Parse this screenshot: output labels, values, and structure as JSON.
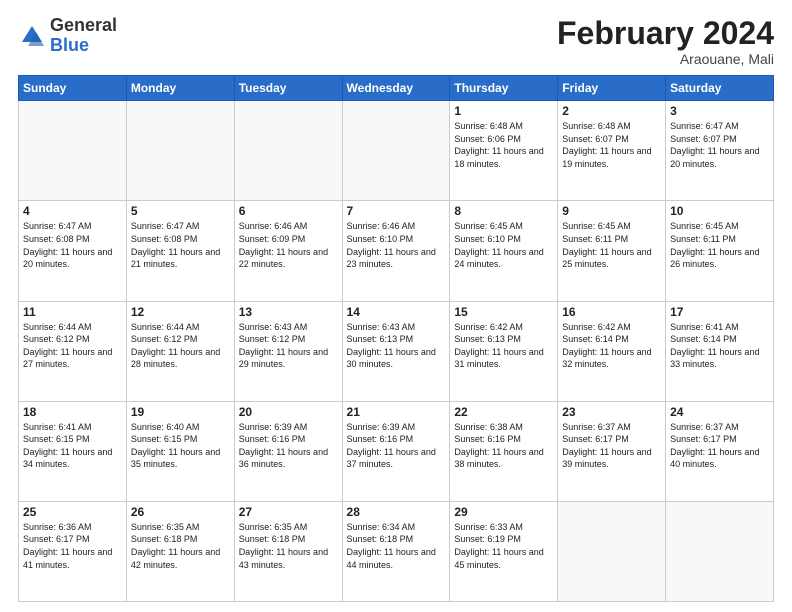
{
  "header": {
    "logo_general": "General",
    "logo_blue": "Blue",
    "month_title": "February 2024",
    "location": "Araouane, Mali"
  },
  "days_of_week": [
    "Sunday",
    "Monday",
    "Tuesday",
    "Wednesday",
    "Thursday",
    "Friday",
    "Saturday"
  ],
  "weeks": [
    [
      {
        "day": "",
        "info": "",
        "empty": true
      },
      {
        "day": "",
        "info": "",
        "empty": true
      },
      {
        "day": "",
        "info": "",
        "empty": true
      },
      {
        "day": "",
        "info": "",
        "empty": true
      },
      {
        "day": "1",
        "info": "Sunrise: 6:48 AM\nSunset: 6:06 PM\nDaylight: 11 hours and 18 minutes.",
        "empty": false
      },
      {
        "day": "2",
        "info": "Sunrise: 6:48 AM\nSunset: 6:07 PM\nDaylight: 11 hours and 19 minutes.",
        "empty": false
      },
      {
        "day": "3",
        "info": "Sunrise: 6:47 AM\nSunset: 6:07 PM\nDaylight: 11 hours and 20 minutes.",
        "empty": false
      }
    ],
    [
      {
        "day": "4",
        "info": "Sunrise: 6:47 AM\nSunset: 6:08 PM\nDaylight: 11 hours and 20 minutes.",
        "empty": false
      },
      {
        "day": "5",
        "info": "Sunrise: 6:47 AM\nSunset: 6:08 PM\nDaylight: 11 hours and 21 minutes.",
        "empty": false
      },
      {
        "day": "6",
        "info": "Sunrise: 6:46 AM\nSunset: 6:09 PM\nDaylight: 11 hours and 22 minutes.",
        "empty": false
      },
      {
        "day": "7",
        "info": "Sunrise: 6:46 AM\nSunset: 6:10 PM\nDaylight: 11 hours and 23 minutes.",
        "empty": false
      },
      {
        "day": "8",
        "info": "Sunrise: 6:45 AM\nSunset: 6:10 PM\nDaylight: 11 hours and 24 minutes.",
        "empty": false
      },
      {
        "day": "9",
        "info": "Sunrise: 6:45 AM\nSunset: 6:11 PM\nDaylight: 11 hours and 25 minutes.",
        "empty": false
      },
      {
        "day": "10",
        "info": "Sunrise: 6:45 AM\nSunset: 6:11 PM\nDaylight: 11 hours and 26 minutes.",
        "empty": false
      }
    ],
    [
      {
        "day": "11",
        "info": "Sunrise: 6:44 AM\nSunset: 6:12 PM\nDaylight: 11 hours and 27 minutes.",
        "empty": false
      },
      {
        "day": "12",
        "info": "Sunrise: 6:44 AM\nSunset: 6:12 PM\nDaylight: 11 hours and 28 minutes.",
        "empty": false
      },
      {
        "day": "13",
        "info": "Sunrise: 6:43 AM\nSunset: 6:12 PM\nDaylight: 11 hours and 29 minutes.",
        "empty": false
      },
      {
        "day": "14",
        "info": "Sunrise: 6:43 AM\nSunset: 6:13 PM\nDaylight: 11 hours and 30 minutes.",
        "empty": false
      },
      {
        "day": "15",
        "info": "Sunrise: 6:42 AM\nSunset: 6:13 PM\nDaylight: 11 hours and 31 minutes.",
        "empty": false
      },
      {
        "day": "16",
        "info": "Sunrise: 6:42 AM\nSunset: 6:14 PM\nDaylight: 11 hours and 32 minutes.",
        "empty": false
      },
      {
        "day": "17",
        "info": "Sunrise: 6:41 AM\nSunset: 6:14 PM\nDaylight: 11 hours and 33 minutes.",
        "empty": false
      }
    ],
    [
      {
        "day": "18",
        "info": "Sunrise: 6:41 AM\nSunset: 6:15 PM\nDaylight: 11 hours and 34 minutes.",
        "empty": false
      },
      {
        "day": "19",
        "info": "Sunrise: 6:40 AM\nSunset: 6:15 PM\nDaylight: 11 hours and 35 minutes.",
        "empty": false
      },
      {
        "day": "20",
        "info": "Sunrise: 6:39 AM\nSunset: 6:16 PM\nDaylight: 11 hours and 36 minutes.",
        "empty": false
      },
      {
        "day": "21",
        "info": "Sunrise: 6:39 AM\nSunset: 6:16 PM\nDaylight: 11 hours and 37 minutes.",
        "empty": false
      },
      {
        "day": "22",
        "info": "Sunrise: 6:38 AM\nSunset: 6:16 PM\nDaylight: 11 hours and 38 minutes.",
        "empty": false
      },
      {
        "day": "23",
        "info": "Sunrise: 6:37 AM\nSunset: 6:17 PM\nDaylight: 11 hours and 39 minutes.",
        "empty": false
      },
      {
        "day": "24",
        "info": "Sunrise: 6:37 AM\nSunset: 6:17 PM\nDaylight: 11 hours and 40 minutes.",
        "empty": false
      }
    ],
    [
      {
        "day": "25",
        "info": "Sunrise: 6:36 AM\nSunset: 6:17 PM\nDaylight: 11 hours and 41 minutes.",
        "empty": false
      },
      {
        "day": "26",
        "info": "Sunrise: 6:35 AM\nSunset: 6:18 PM\nDaylight: 11 hours and 42 minutes.",
        "empty": false
      },
      {
        "day": "27",
        "info": "Sunrise: 6:35 AM\nSunset: 6:18 PM\nDaylight: 11 hours and 43 minutes.",
        "empty": false
      },
      {
        "day": "28",
        "info": "Sunrise: 6:34 AM\nSunset: 6:18 PM\nDaylight: 11 hours and 44 minutes.",
        "empty": false
      },
      {
        "day": "29",
        "info": "Sunrise: 6:33 AM\nSunset: 6:19 PM\nDaylight: 11 hours and 45 minutes.",
        "empty": false
      },
      {
        "day": "",
        "info": "",
        "empty": true
      },
      {
        "day": "",
        "info": "",
        "empty": true
      }
    ]
  ]
}
